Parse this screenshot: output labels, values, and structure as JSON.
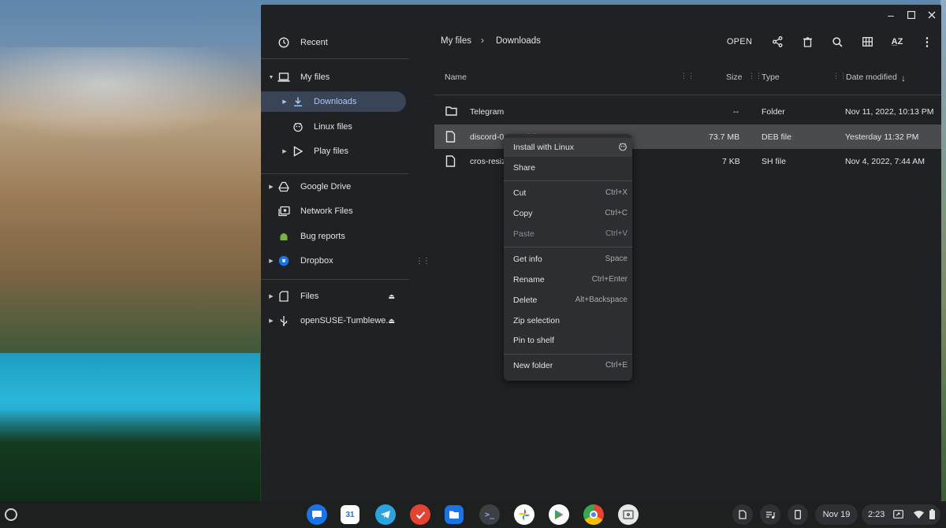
{
  "window": {
    "controls": [
      "minimize-icon",
      "maximize-icon",
      "close-icon"
    ]
  },
  "sidebar": {
    "recent": "Recent",
    "my_files": "My files",
    "downloads": "Downloads",
    "linux_files": "Linux files",
    "play_files": "Play files",
    "google_drive": "Google Drive",
    "network_files": "Network Files",
    "bug_reports": "Bug reports",
    "dropbox": "Dropbox",
    "files": "Files",
    "opensuse": "openSUSE-Tumblewe..."
  },
  "breadcrumb": {
    "root": "My files",
    "current": "Downloads"
  },
  "toolbar": {
    "open_label": "OPEN",
    "icons": [
      "share-icon",
      "delete-icon",
      "search-icon",
      "grid-view-icon",
      "sort-az-icon",
      "more-icon"
    ]
  },
  "columns": {
    "name": "Name",
    "size": "Size",
    "type": "Type",
    "date": "Date modified"
  },
  "files": [
    {
      "name": "Telegram",
      "size": "--",
      "type": "Folder",
      "date": "Nov 11, 2022, 10:13 PM",
      "icon": "folder-icon",
      "selected": false
    },
    {
      "name": "discord-0.0.21.deb",
      "size": "73.7 MB",
      "type": "DEB file",
      "date": "Yesterday 11:32 PM",
      "icon": "file-icon",
      "selected": true
    },
    {
      "name": "cros-resiz",
      "size": "7 KB",
      "type": "SH file",
      "date": "Nov 4, 2022, 7:44 AM",
      "icon": "file-icon",
      "selected": false
    }
  ],
  "context_menu": {
    "install": {
      "label": "Install with Linux",
      "icon": "linux-icon"
    },
    "share": {
      "label": "Share"
    },
    "cut": {
      "label": "Cut",
      "shortcut": "Ctrl+X"
    },
    "copy": {
      "label": "Copy",
      "shortcut": "Ctrl+C"
    },
    "paste": {
      "label": "Paste",
      "shortcut": "Ctrl+V"
    },
    "get_info": {
      "label": "Get info",
      "shortcut": "Space"
    },
    "rename": {
      "label": "Rename",
      "shortcut": "Ctrl+Enter"
    },
    "delete": {
      "label": "Delete",
      "shortcut": "Alt+Backspace"
    },
    "zip": {
      "label": "Zip selection"
    },
    "pin": {
      "label": "Pin to shelf"
    },
    "new_folder": {
      "label": "New folder",
      "shortcut": "Ctrl+E"
    }
  },
  "shelf": {
    "apps": [
      "messages-icon",
      "calendar-icon",
      "telegram-icon",
      "tasks-icon",
      "files-app-icon",
      "terminal-icon",
      "photos-icon",
      "play-store-icon",
      "chrome-icon",
      "screenshot-app-icon"
    ],
    "date": "Nov 19",
    "time": "2:23"
  },
  "colors": {
    "window_bg": "#202124",
    "selection_nav": "#394457",
    "accent_text": "#a8c7fa",
    "menu_bg": "#2d2e31"
  }
}
